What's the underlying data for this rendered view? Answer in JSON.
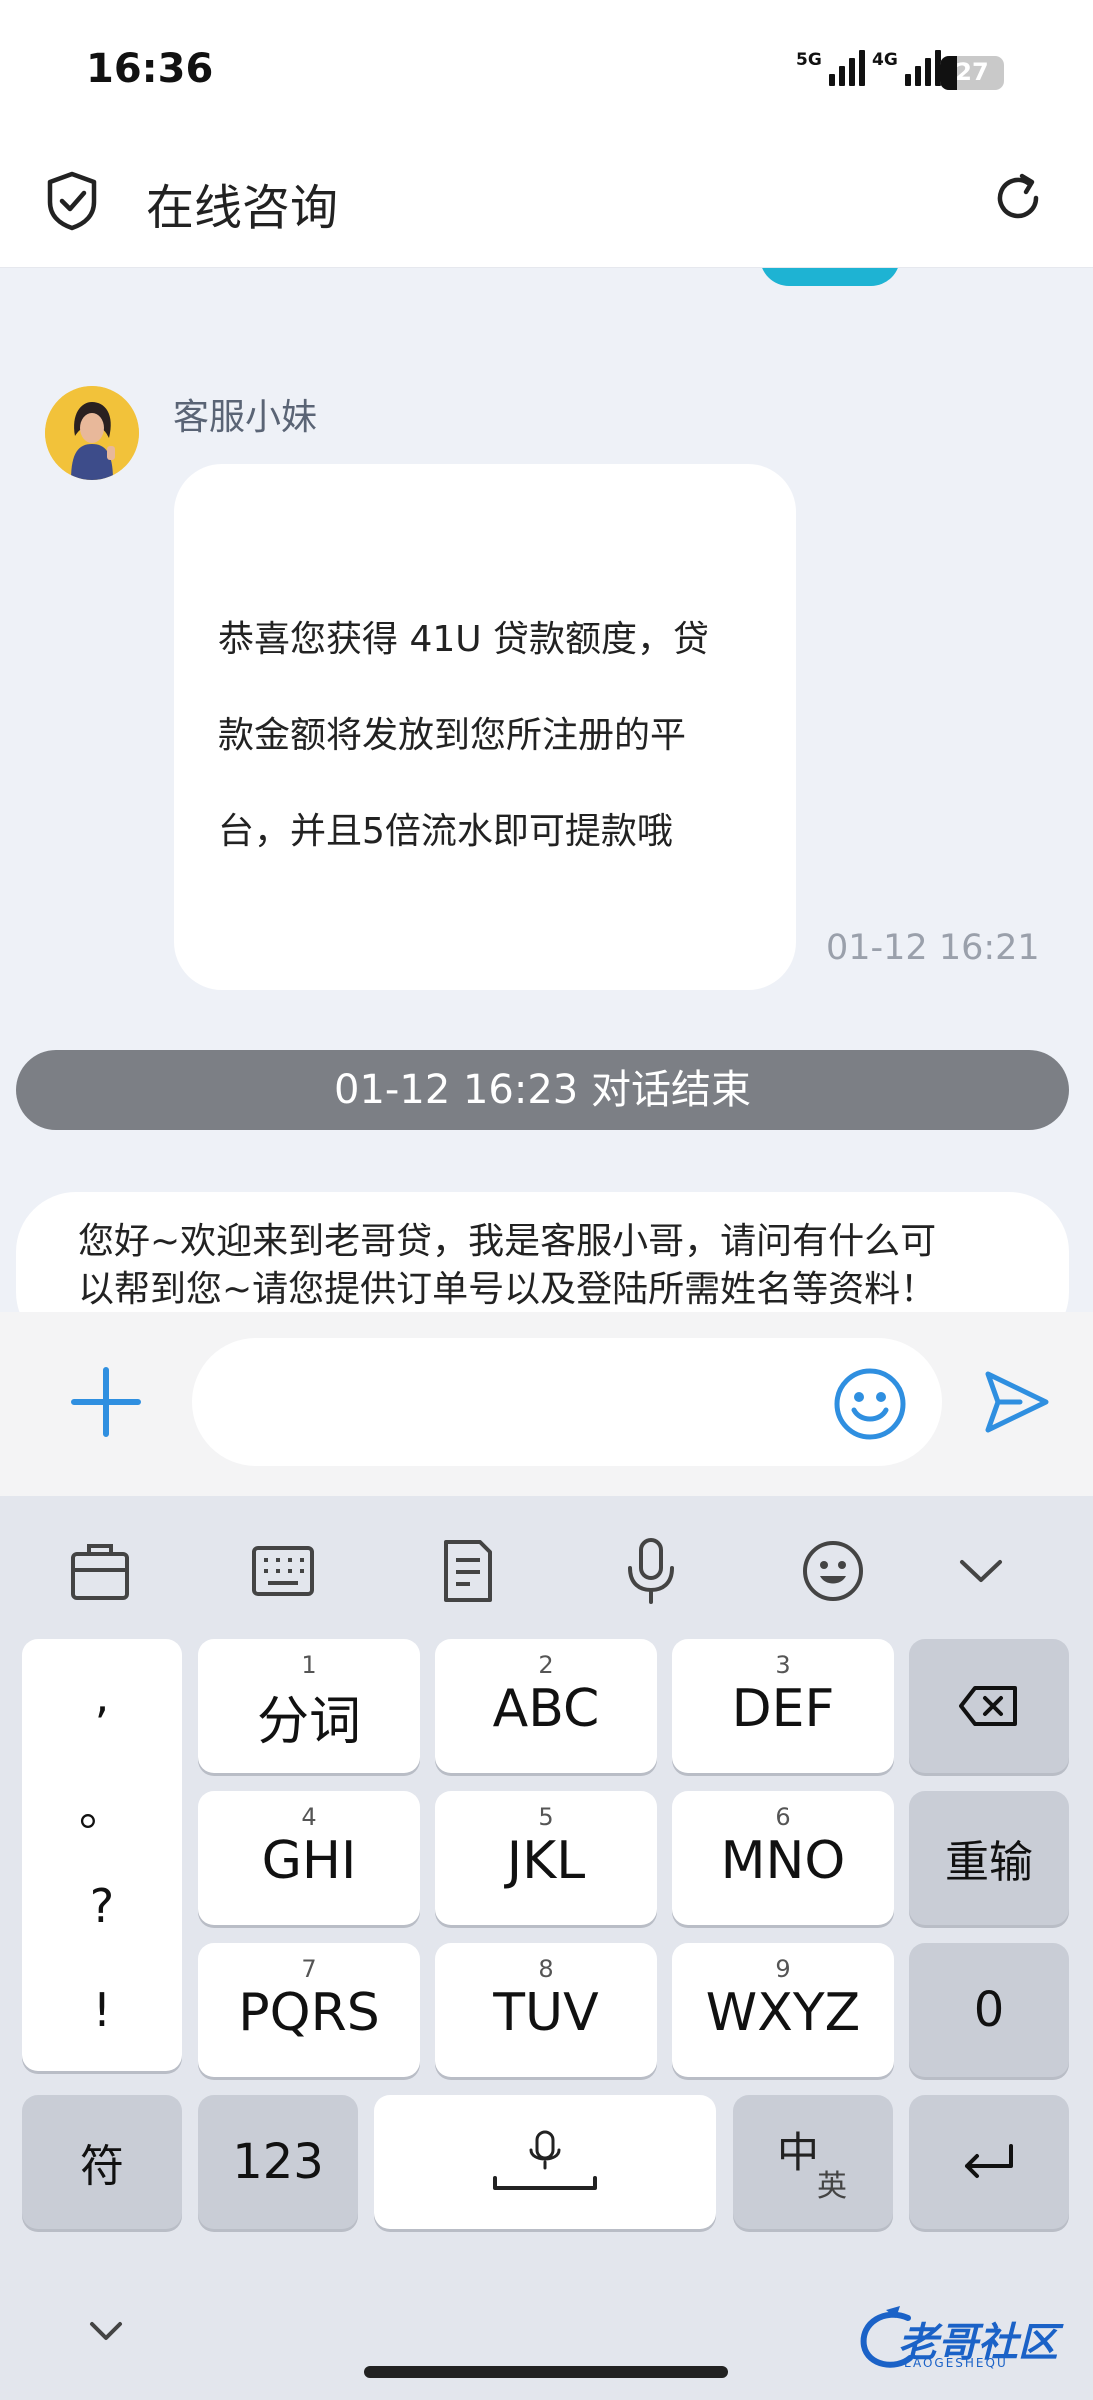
{
  "status_bar": {
    "time": "16:36",
    "signal1_tag": "5G",
    "signal2_tag": "4G",
    "battery": "27",
    "battery_level": 0.27
  },
  "header": {
    "title": "在线咨询",
    "left_icon": "shield-check-icon",
    "right_icon": "refresh-icon"
  },
  "chat": {
    "agent_name": "客服小妹",
    "message_lines": [
      "恭喜您获得 41U 贷款额度，贷",
      "款金额将发放到您所注册的平",
      "台，并且5倍流水即可提款哦"
    ],
    "message_time": "01-12 16:21",
    "end_banner": "01-12 16:23 对话结束",
    "welcome_lines": [
      "您好~欢迎来到老哥贷，我是客服小哥，请问有什么可",
      "以帮到您~请您提供订单号以及登陆所需姓名等资料！"
    ]
  },
  "input_bar": {
    "value": "",
    "placeholder": ""
  },
  "keyboard": {
    "punct": [
      ",",
      "。",
      "?",
      "!"
    ],
    "row1": [
      {
        "num": "1",
        "label": "分词"
      },
      {
        "num": "2",
        "label": "ABC"
      },
      {
        "num": "3",
        "label": "DEF"
      }
    ],
    "row2": [
      {
        "num": "4",
        "label": "GHI"
      },
      {
        "num": "5",
        "label": "JKL"
      },
      {
        "num": "6",
        "label": "MNO"
      }
    ],
    "row3": [
      {
        "num": "7",
        "label": "PQRS"
      },
      {
        "num": "8",
        "label": "TUV"
      },
      {
        "num": "9",
        "label": "WXYZ"
      }
    ],
    "reinput": "重输",
    "zero": "0",
    "symbol": "符",
    "numbers": "123",
    "lang_main": "中",
    "lang_sub": "英"
  },
  "watermark": {
    "text": "老哥社区",
    "sub": "LAOGESHEQU"
  },
  "colors": {
    "accent": "#2f8fe0",
    "end_banner": "#7c7f85",
    "chat_bg": "#eef1f7",
    "keyboard_bg": "#e3e6ed"
  }
}
